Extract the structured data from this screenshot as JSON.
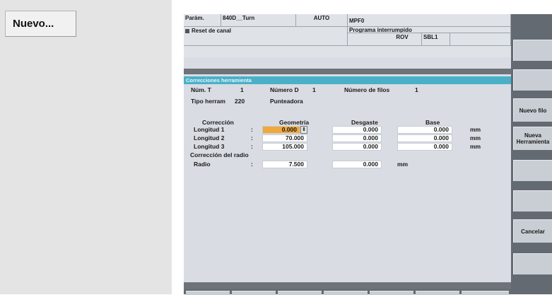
{
  "left": {
    "new_button_label": "Nuevo..."
  },
  "header": {
    "param": "Parám.",
    "machine": "840D__Turn",
    "mode": "AUTO",
    "program": "MPF0",
    "channel_status": "Reset de canal",
    "program_status": "Programa interrumpido",
    "rov": "ROV",
    "sbl": "SBL1"
  },
  "panel": {
    "title": "Correcciones herramienta",
    "num_t_label": "Núm. T",
    "num_t_value": "1",
    "num_d_label": "Número D",
    "num_d_value": "1",
    "num_filos_label": "Número de filos",
    "num_filos_value": "1",
    "tipo_label": "Tipo herram",
    "tipo_value": "220",
    "tipo_name": "Punteadora",
    "col_correccion": "Corrección",
    "col_geometria": "Geometría",
    "col_desgaste": "Desgaste",
    "col_base": "Base",
    "rows": [
      {
        "label": "Longitud 1",
        "sep": ":",
        "geo": "0.000",
        "wear": "0.000",
        "base": "0.000",
        "unit": "mm"
      },
      {
        "label": "Longitud 2",
        "sep": ":",
        "geo": "70.000",
        "wear": "0.000",
        "base": "0.000",
        "unit": "mm"
      },
      {
        "label": "Longitud 3",
        "sep": ":",
        "geo": "105.000",
        "wear": "0.000",
        "base": "0.000",
        "unit": "mm"
      }
    ],
    "radius_section": "Corrección del radio",
    "radius": {
      "label": "Radio",
      "sep": ":",
      "geo": "7.500",
      "wear": "0.000",
      "unit": "mm"
    }
  },
  "softkeys": {
    "nuevo_filo": "Nuevo filo",
    "nueva_herramienta": "Nueva Herramienta",
    "cancelar": "Cancelar"
  }
}
